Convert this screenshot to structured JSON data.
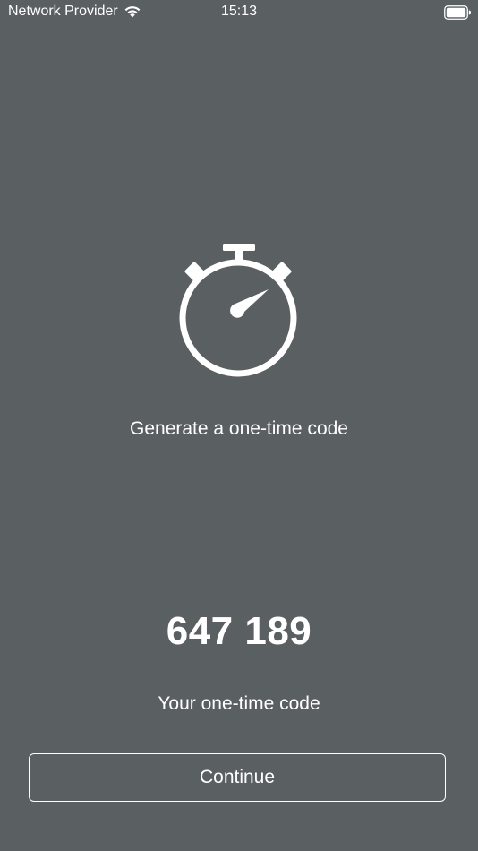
{
  "status_bar": {
    "carrier": "Network Provider",
    "time": "15:13",
    "wifi_icon": "wifi-icon",
    "battery_icon": "battery-full-icon"
  },
  "main": {
    "hero_icon": "stopwatch-icon",
    "headline": "Generate a one-time code",
    "code": "647 189",
    "code_label": "Your one-time code"
  },
  "actions": {
    "continue_label": "Continue"
  },
  "colors": {
    "background": "#5a5f62",
    "foreground": "#ffffff"
  }
}
